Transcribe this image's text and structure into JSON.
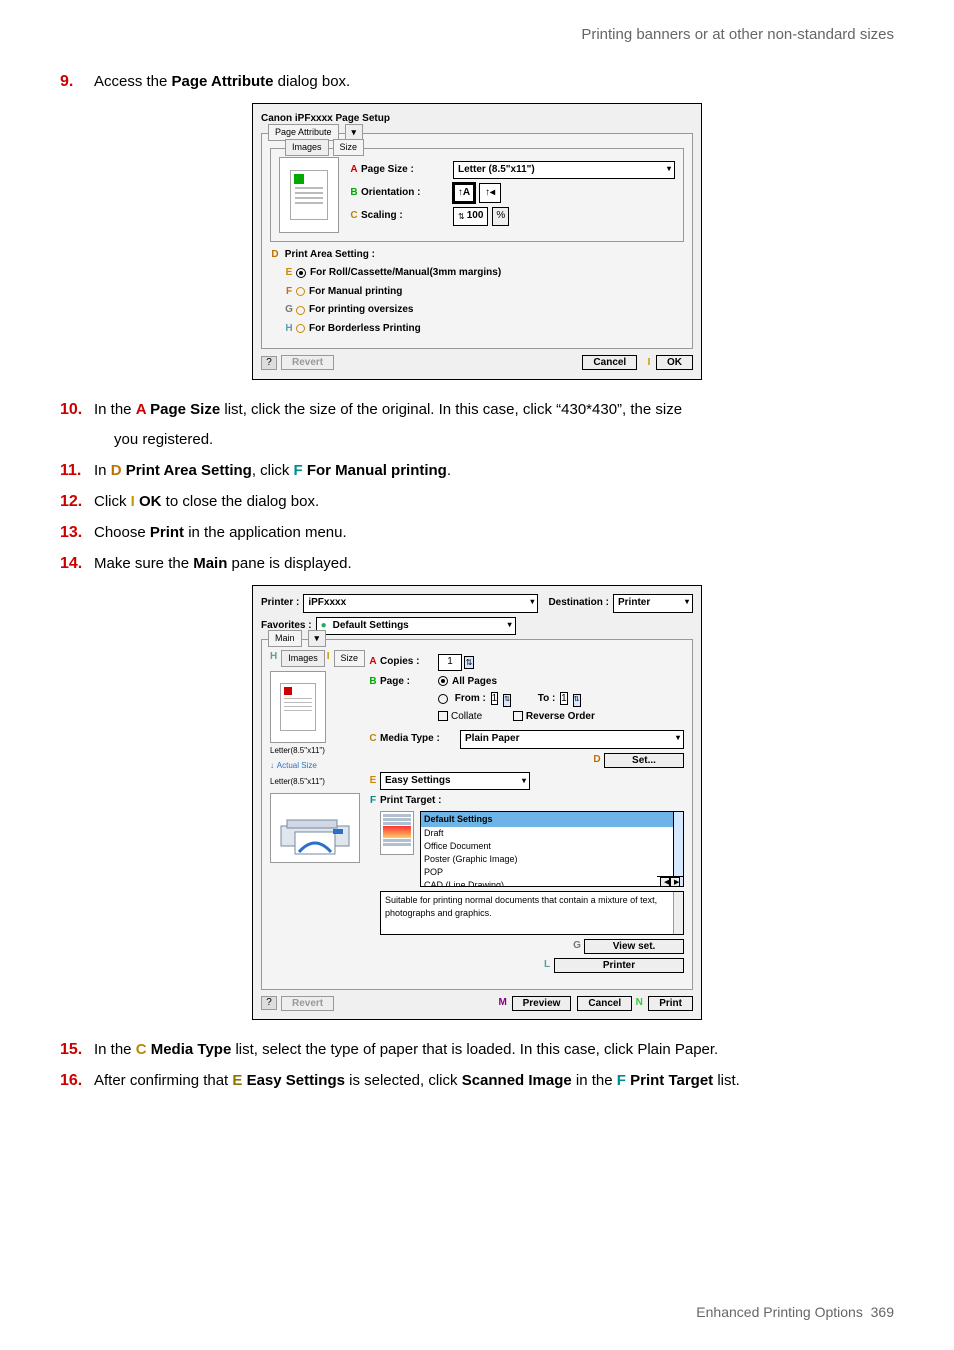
{
  "header_right": "Printing banners or at other non-standard sizes",
  "steps": {
    "s9": {
      "num": "9.",
      "prefix": "Access the ",
      "bold": "Page Attribute",
      "suffix": " dialog box."
    },
    "s10": {
      "num": "10.",
      "t1": "In the ",
      "letA": "A",
      "t2": " Page Size",
      "t3": " list, click the size of the original. In this case, click “430*430”, the size",
      "more": "you registered."
    },
    "s11": {
      "num": "11.",
      "t1": "In ",
      "letD": "D",
      "bold1": " Print Area Setting",
      "t2": ", click ",
      "letF": "F",
      "bold2": " For Manual printing",
      "t3": "."
    },
    "s12": {
      "num": "12.",
      "t1": "Click ",
      "letI": "I",
      "bold": " OK",
      "t2": " to close the dialog box."
    },
    "s13": {
      "num": "13.",
      "t1": "Choose ",
      "bold": "Print",
      "t2": " in the application menu."
    },
    "s14": {
      "num": "14.",
      "t1": "Make sure the ",
      "bold": "Main",
      "t2": " pane is displayed."
    },
    "s15": {
      "num": "15.",
      "t1": "In the ",
      "letC": "C",
      "bold": " Media Type",
      "t2": " list, select the type of paper that is loaded. In this case, click Plain Paper."
    },
    "s16": {
      "num": "16.",
      "t1": "After confirming that ",
      "letE": "E",
      "bold1": " Easy Settings",
      "t2": " is selected, click ",
      "bold2": "Scanned Image",
      "t3": " in the ",
      "letF": "F",
      "bold3": " Print Target",
      "t4": " list."
    }
  },
  "dlg1": {
    "title": "Canon iPFxxxx Page Setup",
    "tab_page_attr": "Page Attribute",
    "tab_images": "Images",
    "tab_size": "Size",
    "l_page_size": "Page Size :",
    "v_page_size": "Letter (8.5\"x11\")",
    "l_orientation": "Orientation :",
    "l_scaling": "Scaling :",
    "v_scaling": "100",
    "pct": "%",
    "print_area": "Print Area Setting :",
    "optE": "For Roll/Cassette/Manual(3mm margins)",
    "optF": "For Manual printing",
    "optG": "For printing oversizes",
    "optH": "For Borderless Printing",
    "revert": "Revert",
    "cancel": "Cancel",
    "ok": "OK"
  },
  "dlg2": {
    "printer_l": "Printer :",
    "printer_v": "iPFxxxx",
    "dest_l": "Destination :",
    "dest_v": "Printer",
    "fav_l": "Favorites :",
    "fav_dot": "●",
    "fav_v": "Default Settings",
    "tab_main": "Main",
    "tab_images": "Images",
    "tab_size": "Size",
    "letters": {
      "H": "H",
      "I": "I",
      "A": "A",
      "B": "B",
      "C": "C",
      "D": "D",
      "E": "E",
      "F": "F",
      "G": "G",
      "L": "L",
      "M": "M",
      "N": "N"
    },
    "copies_l": "Copies :",
    "copies_v": "1",
    "page_l": "Page :",
    "all_pages": "All Pages",
    "from_l": "From :",
    "from_v": "1",
    "to_l": "To :",
    "to_v": "1",
    "collate": "Collate",
    "reverse": "Reverse Order",
    "media_l": "Media Type :",
    "media_v": "Plain Paper",
    "set_btn": "Set...",
    "easy_settings": "Easy Settings",
    "print_target": "Print Target :",
    "size1": "Letter(8.5\"x11\")",
    "actual": "Actual Size",
    "size2": "Letter(8.5\"x11\")",
    "list": {
      "default": "Default Settings",
      "draft": "Draft",
      "office": "Office Document",
      "poster": "Poster (Graphic Image)",
      "pop": "POP",
      "cad": "CAD (Line Drawing)"
    },
    "desc": "Suitable for printing normal documents that contain a mixture of text, photographs and graphics.",
    "view_set": "View set.",
    "printer_btn": "Printer",
    "revert": "Revert",
    "preview": "Preview",
    "cancel": "Cancel",
    "print": "Print"
  },
  "footer": {
    "title": "Enhanced Printing Options",
    "page": "369"
  }
}
